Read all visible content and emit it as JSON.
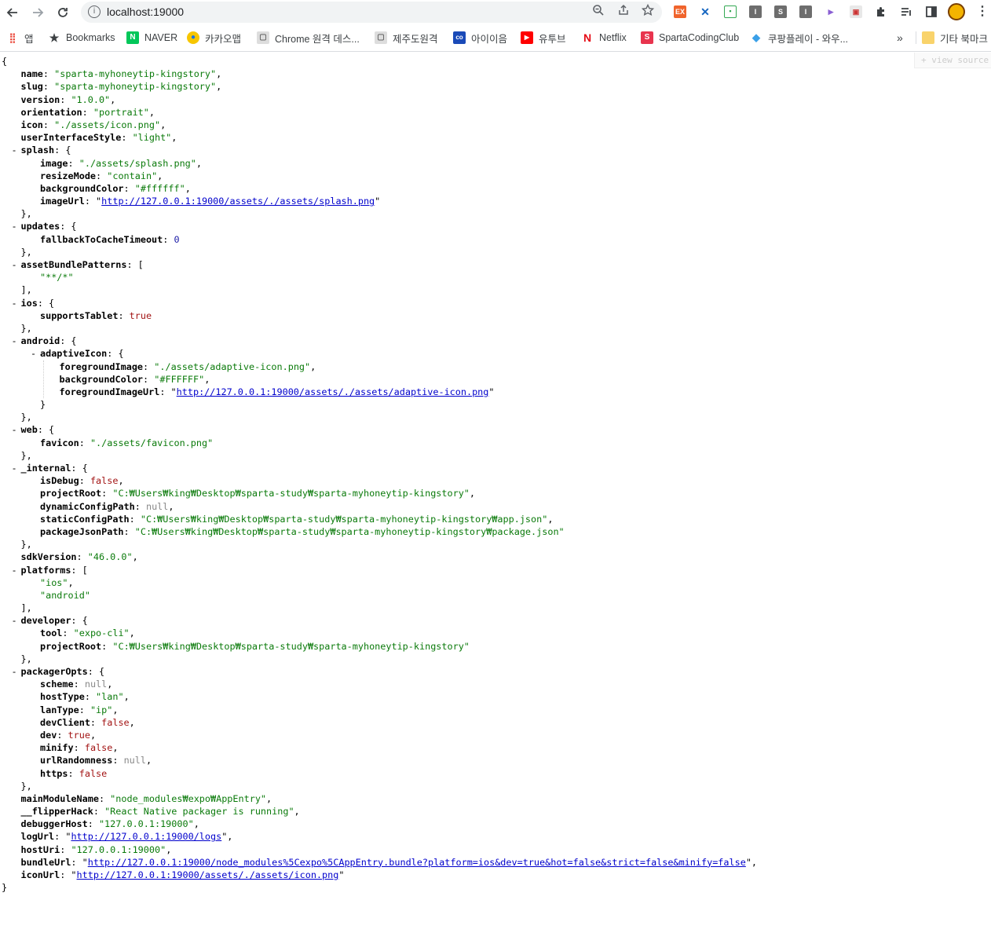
{
  "browser": {
    "url": "localhost:19000",
    "bookmarks": [
      {
        "label": "앱",
        "color": "#ea4335",
        "glyph": "⋮⋮"
      },
      {
        "label": "Bookmarks",
        "color": "#3c4043",
        "glyph": "★"
      },
      {
        "label": "NAVER",
        "color": "#03c75a",
        "glyph": "N"
      },
      {
        "label": "카카오맵",
        "color": "#f7c600",
        "glyph": "●"
      },
      {
        "label": "Chrome 원격 데스...",
        "color": "#e0e0e0",
        "glyph": "▢"
      },
      {
        "label": "제주도원격",
        "color": "#e0e0e0",
        "glyph": "▢"
      },
      {
        "label": "아이이음",
        "color": "#1a4ab8",
        "glyph": "co"
      },
      {
        "label": "유투브",
        "color": "#ff0000",
        "glyph": "▶"
      },
      {
        "label": "Netflix",
        "color": "#e50914",
        "glyph": "N"
      },
      {
        "label": "SpartaCodingClub",
        "color": "#e8344e",
        "glyph": "S"
      },
      {
        "label": "쿠팡플레이 - 와우...",
        "color": "#3aa0e8",
        "glyph": "◆"
      }
    ],
    "more": "»",
    "other_bookmarks": "기타 북마크",
    "view_source": "+ view source"
  },
  "json_lines": [
    {
      "d": 0,
      "t": [
        [
          "p",
          "{"
        ]
      ]
    },
    {
      "d": 1,
      "t": [
        [
          "k",
          "name"
        ],
        [
          "p",
          ": "
        ],
        [
          "s",
          "\"sparta-myhoneytip-kingstory\""
        ],
        [
          "p",
          ","
        ]
      ]
    },
    {
      "d": 1,
      "t": [
        [
          "k",
          "slug"
        ],
        [
          "p",
          ": "
        ],
        [
          "s",
          "\"sparta-myhoneytip-kingstory\""
        ],
        [
          "p",
          ","
        ]
      ]
    },
    {
      "d": 1,
      "t": [
        [
          "k",
          "version"
        ],
        [
          "p",
          ": "
        ],
        [
          "s",
          "\"1.0.0\""
        ],
        [
          "p",
          ","
        ]
      ]
    },
    {
      "d": 1,
      "t": [
        [
          "k",
          "orientation"
        ],
        [
          "p",
          ": "
        ],
        [
          "s",
          "\"portrait\""
        ],
        [
          "p",
          ","
        ]
      ]
    },
    {
      "d": 1,
      "t": [
        [
          "k",
          "icon"
        ],
        [
          "p",
          ": "
        ],
        [
          "s",
          "\"./assets/icon.png\""
        ],
        [
          "p",
          ","
        ]
      ]
    },
    {
      "d": 1,
      "t": [
        [
          "k",
          "userInterfaceStyle"
        ],
        [
          "p",
          ": "
        ],
        [
          "s",
          "\"light\""
        ],
        [
          "p",
          ","
        ]
      ]
    },
    {
      "d": 1,
      "c": 1,
      "t": [
        [
          "k",
          "splash"
        ],
        [
          "p",
          ": {"
        ]
      ]
    },
    {
      "d": 2,
      "t": [
        [
          "k",
          "image"
        ],
        [
          "p",
          ": "
        ],
        [
          "s",
          "\"./assets/splash.png\""
        ],
        [
          "p",
          ","
        ]
      ]
    },
    {
      "d": 2,
      "t": [
        [
          "k",
          "resizeMode"
        ],
        [
          "p",
          ": "
        ],
        [
          "s",
          "\"contain\""
        ],
        [
          "p",
          ","
        ]
      ]
    },
    {
      "d": 2,
      "t": [
        [
          "k",
          "backgroundColor"
        ],
        [
          "p",
          ": "
        ],
        [
          "s",
          "\"#ffffff\""
        ],
        [
          "p",
          ","
        ]
      ]
    },
    {
      "d": 2,
      "t": [
        [
          "k",
          "imageUrl"
        ],
        [
          "p",
          ": \""
        ],
        [
          "a",
          "http://127.0.0.1:19000/assets/./assets/splash.png"
        ],
        [
          "p",
          "\""
        ]
      ]
    },
    {
      "d": 1,
      "t": [
        [
          "p",
          "},"
        ]
      ]
    },
    {
      "d": 1,
      "c": 1,
      "t": [
        [
          "k",
          "updates"
        ],
        [
          "p",
          ": {"
        ]
      ]
    },
    {
      "d": 2,
      "t": [
        [
          "k",
          "fallbackToCacheTimeout"
        ],
        [
          "p",
          ": "
        ],
        [
          "n",
          "0"
        ]
      ]
    },
    {
      "d": 1,
      "t": [
        [
          "p",
          "},"
        ]
      ]
    },
    {
      "d": 1,
      "c": 1,
      "t": [
        [
          "k",
          "assetBundlePatterns"
        ],
        [
          "p",
          ": ["
        ]
      ]
    },
    {
      "d": 2,
      "t": [
        [
          "s",
          "\"**/*\""
        ]
      ]
    },
    {
      "d": 1,
      "t": [
        [
          "p",
          "],"
        ]
      ]
    },
    {
      "d": 1,
      "c": 1,
      "t": [
        [
          "k",
          "ios"
        ],
        [
          "p",
          ": {"
        ]
      ]
    },
    {
      "d": 2,
      "t": [
        [
          "k",
          "supportsTablet"
        ],
        [
          "p",
          ": "
        ],
        [
          "b",
          "true"
        ]
      ]
    },
    {
      "d": 1,
      "t": [
        [
          "p",
          "},"
        ]
      ]
    },
    {
      "d": 1,
      "c": 1,
      "t": [
        [
          "k",
          "android"
        ],
        [
          "p",
          ": {"
        ]
      ]
    },
    {
      "d": 2,
      "c": 1,
      "t": [
        [
          "k",
          "adaptiveIcon"
        ],
        [
          "p",
          ": {"
        ]
      ]
    },
    {
      "d": 3,
      "t": [
        [
          "k",
          "foregroundImage"
        ],
        [
          "p",
          ": "
        ],
        [
          "s",
          "\"./assets/adaptive-icon.png\""
        ],
        [
          "p",
          ","
        ]
      ]
    },
    {
      "d": 3,
      "t": [
        [
          "k",
          "backgroundColor"
        ],
        [
          "p",
          ": "
        ],
        [
          "s",
          "\"#FFFFFF\""
        ],
        [
          "p",
          ","
        ]
      ]
    },
    {
      "d": 3,
      "t": [
        [
          "k",
          "foregroundImageUrl"
        ],
        [
          "p",
          ": \""
        ],
        [
          "a",
          "http://127.0.0.1:19000/assets/./assets/adaptive-icon.png"
        ],
        [
          "p",
          "\""
        ]
      ]
    },
    {
      "d": 2,
      "t": [
        [
          "p",
          "}"
        ]
      ]
    },
    {
      "d": 1,
      "t": [
        [
          "p",
          "},"
        ]
      ]
    },
    {
      "d": 1,
      "c": 1,
      "t": [
        [
          "k",
          "web"
        ],
        [
          "p",
          ": {"
        ]
      ]
    },
    {
      "d": 2,
      "t": [
        [
          "k",
          "favicon"
        ],
        [
          "p",
          ": "
        ],
        [
          "s",
          "\"./assets/favicon.png\""
        ]
      ]
    },
    {
      "d": 1,
      "t": [
        [
          "p",
          "},"
        ]
      ]
    },
    {
      "d": 1,
      "c": 1,
      "t": [
        [
          "k",
          "_internal"
        ],
        [
          "p",
          ": {"
        ]
      ]
    },
    {
      "d": 2,
      "t": [
        [
          "k",
          "isDebug"
        ],
        [
          "p",
          ": "
        ],
        [
          "b",
          "false"
        ],
        [
          "p",
          ","
        ]
      ]
    },
    {
      "d": 2,
      "t": [
        [
          "k",
          "projectRoot"
        ],
        [
          "p",
          ": "
        ],
        [
          "s",
          "\"C:₩Users₩king₩Desktop₩sparta-study₩sparta-myhoneytip-kingstory\""
        ],
        [
          "p",
          ","
        ]
      ]
    },
    {
      "d": 2,
      "t": [
        [
          "k",
          "dynamicConfigPath"
        ],
        [
          "p",
          ": "
        ],
        [
          "nl",
          "null"
        ],
        [
          "p",
          ","
        ]
      ]
    },
    {
      "d": 2,
      "t": [
        [
          "k",
          "staticConfigPath"
        ],
        [
          "p",
          ": "
        ],
        [
          "s",
          "\"C:₩Users₩king₩Desktop₩sparta-study₩sparta-myhoneytip-kingstory₩app.json\""
        ],
        [
          "p",
          ","
        ]
      ]
    },
    {
      "d": 2,
      "t": [
        [
          "k",
          "packageJsonPath"
        ],
        [
          "p",
          ": "
        ],
        [
          "s",
          "\"C:₩Users₩king₩Desktop₩sparta-study₩sparta-myhoneytip-kingstory₩package.json\""
        ]
      ]
    },
    {
      "d": 1,
      "t": [
        [
          "p",
          "},"
        ]
      ]
    },
    {
      "d": 1,
      "t": [
        [
          "k",
          "sdkVersion"
        ],
        [
          "p",
          ": "
        ],
        [
          "s",
          "\"46.0.0\""
        ],
        [
          "p",
          ","
        ]
      ]
    },
    {
      "d": 1,
      "c": 1,
      "t": [
        [
          "k",
          "platforms"
        ],
        [
          "p",
          ": ["
        ]
      ]
    },
    {
      "d": 2,
      "t": [
        [
          "s",
          "\"ios\""
        ],
        [
          "p",
          ","
        ]
      ]
    },
    {
      "d": 2,
      "t": [
        [
          "s",
          "\"android\""
        ]
      ]
    },
    {
      "d": 1,
      "t": [
        [
          "p",
          "],"
        ]
      ]
    },
    {
      "d": 1,
      "c": 1,
      "t": [
        [
          "k",
          "developer"
        ],
        [
          "p",
          ": {"
        ]
      ]
    },
    {
      "d": 2,
      "t": [
        [
          "k",
          "tool"
        ],
        [
          "p",
          ": "
        ],
        [
          "s",
          "\"expo-cli\""
        ],
        [
          "p",
          ","
        ]
      ]
    },
    {
      "d": 2,
      "t": [
        [
          "k",
          "projectRoot"
        ],
        [
          "p",
          ": "
        ],
        [
          "s",
          "\"C:₩Users₩king₩Desktop₩sparta-study₩sparta-myhoneytip-kingstory\""
        ]
      ]
    },
    {
      "d": 1,
      "t": [
        [
          "p",
          "},"
        ]
      ]
    },
    {
      "d": 1,
      "c": 1,
      "t": [
        [
          "k",
          "packagerOpts"
        ],
        [
          "p",
          ": {"
        ]
      ]
    },
    {
      "d": 2,
      "t": [
        [
          "k",
          "scheme"
        ],
        [
          "p",
          ": "
        ],
        [
          "nl",
          "null"
        ],
        [
          "p",
          ","
        ]
      ]
    },
    {
      "d": 2,
      "t": [
        [
          "k",
          "hostType"
        ],
        [
          "p",
          ": "
        ],
        [
          "s",
          "\"lan\""
        ],
        [
          "p",
          ","
        ]
      ]
    },
    {
      "d": 2,
      "t": [
        [
          "k",
          "lanType"
        ],
        [
          "p",
          ": "
        ],
        [
          "s",
          "\"ip\""
        ],
        [
          "p",
          ","
        ]
      ]
    },
    {
      "d": 2,
      "t": [
        [
          "k",
          "devClient"
        ],
        [
          "p",
          ": "
        ],
        [
          "b",
          "false"
        ],
        [
          "p",
          ","
        ]
      ]
    },
    {
      "d": 2,
      "t": [
        [
          "k",
          "dev"
        ],
        [
          "p",
          ": "
        ],
        [
          "b",
          "true"
        ],
        [
          "p",
          ","
        ]
      ]
    },
    {
      "d": 2,
      "t": [
        [
          "k",
          "minify"
        ],
        [
          "p",
          ": "
        ],
        [
          "b",
          "false"
        ],
        [
          "p",
          ","
        ]
      ]
    },
    {
      "d": 2,
      "t": [
        [
          "k",
          "urlRandomness"
        ],
        [
          "p",
          ": "
        ],
        [
          "nl",
          "null"
        ],
        [
          "p",
          ","
        ]
      ]
    },
    {
      "d": 2,
      "t": [
        [
          "k",
          "https"
        ],
        [
          "p",
          ": "
        ],
        [
          "b",
          "false"
        ]
      ]
    },
    {
      "d": 1,
      "t": [
        [
          "p",
          "},"
        ]
      ]
    },
    {
      "d": 1,
      "t": [
        [
          "k",
          "mainModuleName"
        ],
        [
          "p",
          ": "
        ],
        [
          "s",
          "\"node_modules₩expo₩AppEntry\""
        ],
        [
          "p",
          ","
        ]
      ]
    },
    {
      "d": 1,
      "t": [
        [
          "k",
          "__flipperHack"
        ],
        [
          "p",
          ": "
        ],
        [
          "s",
          "\"React Native packager is running\""
        ],
        [
          "p",
          ","
        ]
      ]
    },
    {
      "d": 1,
      "t": [
        [
          "k",
          "debuggerHost"
        ],
        [
          "p",
          ": "
        ],
        [
          "s",
          "\"127.0.0.1:19000\""
        ],
        [
          "p",
          ","
        ]
      ]
    },
    {
      "d": 1,
      "t": [
        [
          "k",
          "logUrl"
        ],
        [
          "p",
          ": \""
        ],
        [
          "a",
          "http://127.0.0.1:19000/logs"
        ],
        [
          "p",
          "\","
        ]
      ]
    },
    {
      "d": 1,
      "t": [
        [
          "k",
          "hostUri"
        ],
        [
          "p",
          ": "
        ],
        [
          "s",
          "\"127.0.0.1:19000\""
        ],
        [
          "p",
          ","
        ]
      ]
    },
    {
      "d": 1,
      "t": [
        [
          "k",
          "bundleUrl"
        ],
        [
          "p",
          ": \""
        ],
        [
          "a",
          "http://127.0.0.1:19000/node_modules%5Cexpo%5CAppEntry.bundle?platform=ios&dev=true&hot=false&strict=false&minify=false"
        ],
        [
          "p",
          "\","
        ]
      ]
    },
    {
      "d": 1,
      "t": [
        [
          "k",
          "iconUrl"
        ],
        [
          "p",
          ": \""
        ],
        [
          "a",
          "http://127.0.0.1:19000/assets/./assets/icon.png"
        ],
        [
          "p",
          "\""
        ]
      ]
    },
    {
      "d": 0,
      "t": [
        [
          "p",
          "}"
        ]
      ]
    }
  ]
}
